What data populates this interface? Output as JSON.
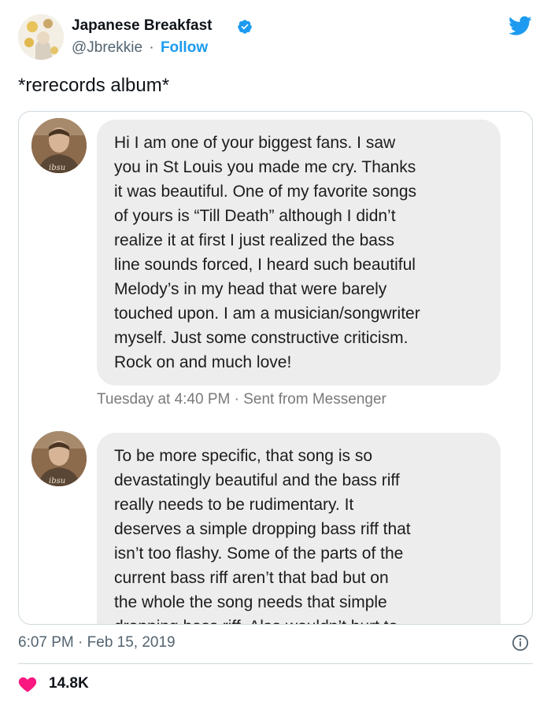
{
  "author": {
    "name": "Japanese Breakfast",
    "handle": "@Jbrekkie",
    "separator": "·",
    "follow_label": "Follow"
  },
  "tweet": {
    "text": "*rerecords album*",
    "timestamp": "6:07 PM · Feb 15, 2019",
    "likes": "14.8K"
  },
  "messages": [
    {
      "lines": [
        "Hi I am one of your biggest fans. I saw",
        "you in St Louis you made me cry. Thanks",
        "it was beautiful. One of my favorite songs",
        "of yours is “Till Death” although I didn’t",
        "realize it at first I just realized the bass",
        "line sounds forced, I heard such beautiful",
        "Melody’s in my head that were barely",
        "touched upon. I am a musician/songwriter",
        "myself. Just some constructive criticism.",
        "Rock on and much love!"
      ],
      "meta": "Tuesday at 4:40 PM · Sent from Messenger"
    },
    {
      "lines": [
        "To be more specific, that song is so",
        "devastatingly beautiful and the bass riff",
        "really needs to be rudimentary. It",
        "deserves a simple dropping bass riff that",
        "isn’t too flashy. Some of the parts of the",
        "current bass riff aren’t that bad but on",
        "the whole the song needs that simple",
        "dropping bass riff. Also wouldn’t hurt to"
      ]
    }
  ],
  "colors": {
    "twitter_blue": "#1d9bf0",
    "like_pink": "#f91880",
    "bubble_gray": "#ededed"
  },
  "icons": {
    "verified": "verified-badge-icon",
    "brand": "twitter-bird-icon",
    "info": "info-icon",
    "like": "heart-icon"
  }
}
